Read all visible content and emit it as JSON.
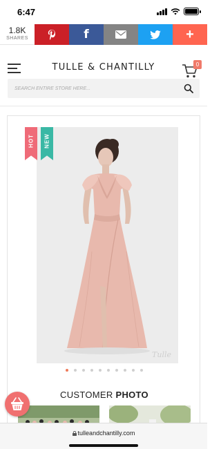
{
  "status_bar": {
    "time": "6:47"
  },
  "share_bar": {
    "count": "1.8K",
    "count_label": "SHARES",
    "buttons": [
      {
        "icon": "pinterest-icon",
        "glyph": "P",
        "color": "#cb2027"
      },
      {
        "icon": "facebook-icon",
        "glyph": "f",
        "color": "#3b5998"
      },
      {
        "icon": "email-icon",
        "glyph": "✉",
        "color": "#848484"
      },
      {
        "icon": "twitter-icon",
        "glyph": "t",
        "color": "#1da1f2"
      },
      {
        "icon": "more-share-icon",
        "glyph": "+",
        "color": "#ff6550"
      }
    ]
  },
  "header": {
    "brand": "TULLE & CHANTILLY",
    "cart_count": "0"
  },
  "search": {
    "placeholder": "SEARCH ENTIRE STORE HERE..."
  },
  "product": {
    "badges": [
      "HOT",
      "NEW"
    ],
    "watermark": "Tulle",
    "carousel": {
      "total": 10,
      "active": 1
    }
  },
  "customer_photo": {
    "title_regular": "CUSTOMER",
    "title_bold": "PHOTO"
  },
  "url_bar": {
    "url": "tulleandchantilly.com"
  },
  "colors": {
    "accent": "#ef7a5a",
    "badge_hot": "#ef6b78",
    "badge_new": "#3ab8a5",
    "dress": "#e8b9ad"
  }
}
